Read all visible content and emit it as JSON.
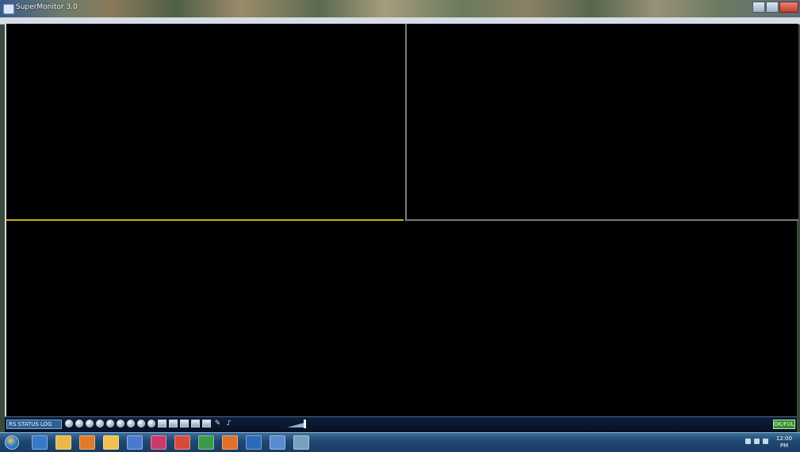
{
  "window": {
    "title": "SuperMonitor 3.0"
  },
  "toolbar": {
    "status_label": "RS STATUS LOG",
    "icons": [
      "play-icon",
      "pause-icon",
      "stop-icon",
      "record-icon",
      "snapshot-icon",
      "ptz-icon",
      "zoom-in-icon",
      "zoom-out-icon",
      "focus-icon",
      "grid-icon",
      "layout-1-icon",
      "layout-4-icon",
      "layout-9-icon",
      "fullscreen-icon",
      "tools-icon",
      "speaker-icon"
    ],
    "right_button_label": "OK/FULL"
  },
  "taskbar": {
    "apps": [
      {
        "name": "taskbar-ie",
        "color": "#3a78c8"
      },
      {
        "name": "taskbar-explorer",
        "color": "#e8b84a"
      },
      {
        "name": "taskbar-media",
        "color": "#e07a2a"
      },
      {
        "name": "taskbar-folder",
        "color": "#f0c050"
      },
      {
        "name": "taskbar-word",
        "color": "#4a7ad0"
      },
      {
        "name": "taskbar-app-red",
        "color": "#c83a6a"
      },
      {
        "name": "taskbar-pdf",
        "color": "#d84a3a"
      },
      {
        "name": "taskbar-sheet",
        "color": "#3a9a4a"
      },
      {
        "name": "taskbar-firefox",
        "color": "#e0702a"
      },
      {
        "name": "taskbar-outlook",
        "color": "#2a6ab8"
      },
      {
        "name": "taskbar-monitor",
        "color": "#5a8ad0"
      },
      {
        "name": "taskbar-network",
        "color": "#7aa0c0"
      }
    ],
    "clock_time": "12:00",
    "clock_date": "PM"
  }
}
